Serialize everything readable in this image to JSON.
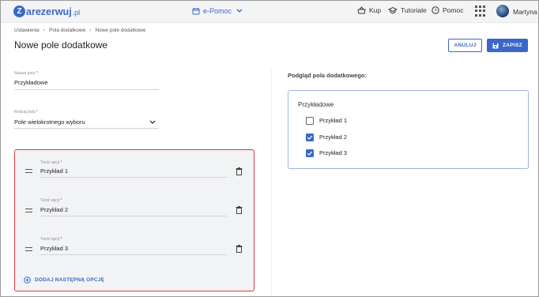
{
  "topbar": {
    "logo_text": "arezerwuj",
    "logo_letter": "Z",
    "logo_suffix": ".pl",
    "module_label": "e-Pomoc",
    "nav": {
      "buy": "Kup",
      "tutorials": "Tutoriale",
      "help": "Pomoc"
    },
    "user_name": "Martyna"
  },
  "breadcrumb": [
    "Ustawienia",
    "Pola dodatkowe",
    "Nowe pole dodatkowe"
  ],
  "page_title": "Nowe pole dodatkowe",
  "actions": {
    "cancel": "ANULUJ",
    "save": "ZAPISZ"
  },
  "form": {
    "name_label": "Nazwa pola",
    "name_value": "Przykładowe",
    "type_label": "Rodzaj pola",
    "type_value": "Pole wielokrotnego wyboru",
    "required_mark": "*"
  },
  "options": [
    {
      "label": "Treść opcji",
      "value": "Przykład 1"
    },
    {
      "label": "Treść opcji",
      "value": "Przykład 2"
    },
    {
      "label": "Treść opcji",
      "value": "Przykład 3"
    }
  ],
  "add_option": "DODAJ NASTĘPNĄ OPCJĘ",
  "preview": {
    "title": "Podgląd pola dodatkowego:",
    "field_name": "Przykładowe",
    "items": [
      {
        "label": "Przykład 1",
        "checked": false
      },
      {
        "label": "Przykład 2",
        "checked": true
      },
      {
        "label": "Przykład 3",
        "checked": true
      }
    ]
  },
  "colors": {
    "accent": "#3a67c9",
    "error_border": "#e0373d",
    "panel_bg": "#f2f3f5"
  }
}
